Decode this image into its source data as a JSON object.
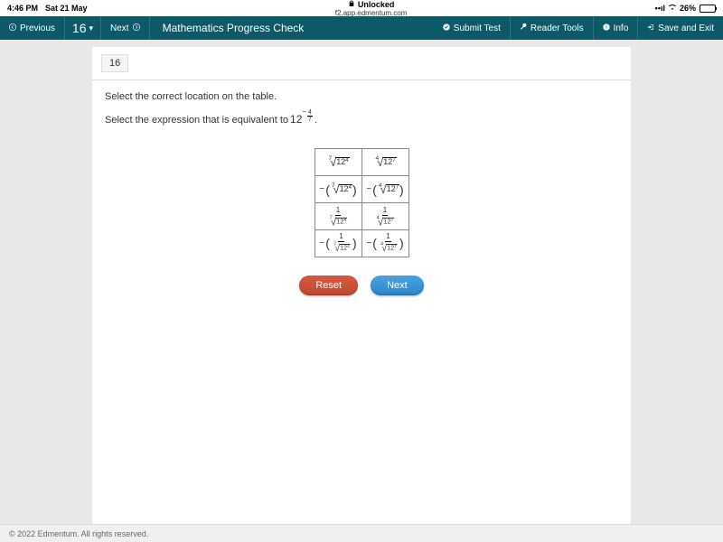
{
  "status_bar": {
    "time": "4:46 PM",
    "date": "Sat 21 May",
    "lock_text": "Unlocked",
    "url": "f2.app.edmentum.com",
    "battery_pct": "26%"
  },
  "nav": {
    "previous": "Previous",
    "question_num": "16",
    "next": "Next",
    "title": "Mathematics Progress Check",
    "submit": "Submit Test",
    "reader": "Reader Tools",
    "info": "Info",
    "save_exit": "Save and Exit"
  },
  "question": {
    "number": "16",
    "instruction": "Select the correct location on the table.",
    "prompt_prefix": "Select the expression that is equivalent to ",
    "base": "12",
    "exp_num": "4",
    "exp_den": "7",
    "period": "."
  },
  "table": {
    "r1c1_idx": "7",
    "r1c1_base": "12",
    "r1c1_pow": "4",
    "r1c2_idx": "4",
    "r1c2_base": "12",
    "r1c2_pow": "7",
    "r2c1_idx": "7",
    "r2c1_base": "12",
    "r2c1_pow": "4",
    "r2c2_idx": "4",
    "r2c2_base": "12",
    "r2c2_pow": "7",
    "r3c1_num": "1",
    "r3c1_idx": "7",
    "r3c1_base": "12",
    "r3c1_pow": "4",
    "r3c2_num": "1",
    "r3c2_idx": "4",
    "r3c2_base": "12",
    "r3c2_pow": "7",
    "r4c1_num": "1",
    "r4c1_idx": "7",
    "r4c1_base": "12",
    "r4c1_pow": "4",
    "r4c2_num": "1",
    "r4c2_idx": "4",
    "r4c2_base": "12",
    "r4c2_pow": "7"
  },
  "buttons": {
    "reset": "Reset",
    "next": "Next"
  },
  "footer": "© 2022 Edmentum. All rights reserved."
}
